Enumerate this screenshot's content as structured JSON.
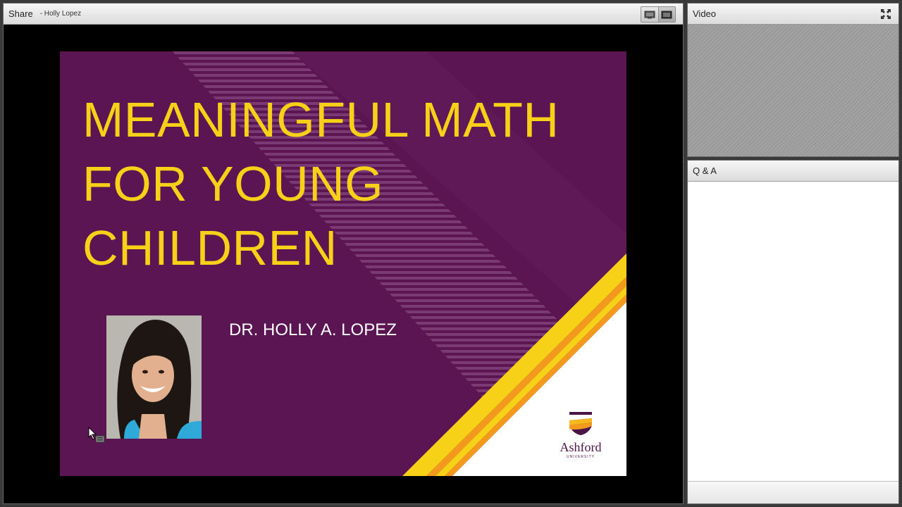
{
  "share": {
    "title": "Share",
    "subtitle": "- Holly Lopez"
  },
  "slide": {
    "title_lines": [
      "MEANINGFUL MATH",
      "FOR YOUNG",
      "CHILDREN"
    ],
    "presenter": "DR. HOLLY A. LOPEZ",
    "logo_word": "Ashford",
    "logo_sub": "UNIVERSITY"
  },
  "video": {
    "title": "Video"
  },
  "qa": {
    "title": "Q & A"
  },
  "colors": {
    "slide_bg": "#5a1552",
    "title_yellow": "#f7d117",
    "stripe_orange": "#f39a1e"
  },
  "icons": {
    "view_toggle": [
      "monitor-icon",
      "presenter-view-icon"
    ],
    "fullscreen": "fullscreen-icon",
    "cursor": "mouse-cursor-icon"
  }
}
